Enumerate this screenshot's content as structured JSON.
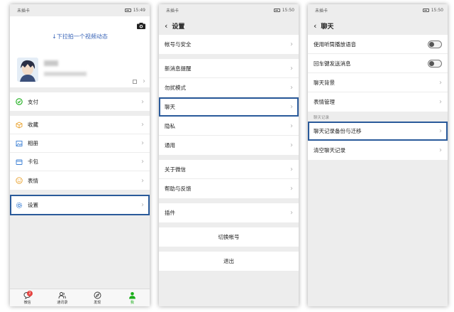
{
  "status": {
    "carrier": "未插卡",
    "time1": "15:49",
    "time2": "15:50",
    "time3": "15:50"
  },
  "me": {
    "pull_hint": "↓下拉拍一个视频动态",
    "items": [
      {
        "label": "支付"
      },
      {
        "label": "收藏"
      },
      {
        "label": "相册"
      },
      {
        "label": "卡包"
      },
      {
        "label": "表情"
      },
      {
        "label": "设置"
      }
    ],
    "tabs": [
      {
        "label": "微信",
        "badge": "2"
      },
      {
        "label": "通讯录"
      },
      {
        "label": "发现"
      },
      {
        "label": "我"
      }
    ]
  },
  "settings": {
    "title": "设置",
    "groups": [
      [
        "帐号与安全"
      ],
      [
        "新消息提醒",
        "勿扰模式",
        "聊天",
        "隐私",
        "通用"
      ],
      [
        "关于微信",
        "帮助与反馈"
      ],
      [
        "插件"
      ]
    ],
    "switch_account": "切换帐号",
    "logout": "退出"
  },
  "chat": {
    "title": "聊天",
    "items": [
      "使用听筒播放语音",
      "回车键发送消息",
      "聊天背景",
      "表情管理"
    ],
    "section_label": "聊天记录",
    "record_items": [
      "聊天记录备份与迁移",
      "清空聊天记录"
    ]
  },
  "colors": {
    "highlight": "#2a5a9a",
    "accent": "#1aad19",
    "link": "#3b66b8"
  }
}
